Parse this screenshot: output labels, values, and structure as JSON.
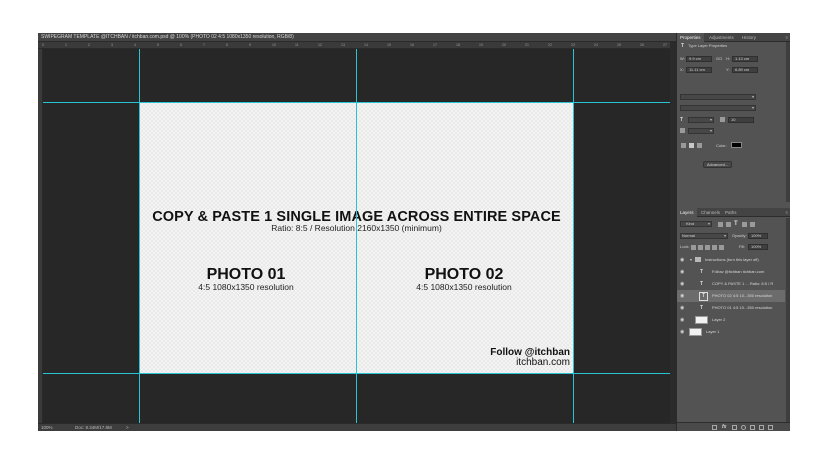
{
  "document": {
    "tab_title": "SWIPEGRAM TEMPLATE @ITCHBAN / itchban.com.psd @ 100% (PHOTO 02 4:5 1080x1350 resolution, RGB/8)"
  },
  "ruler": {
    "ticks": [
      "0",
      "1",
      "2",
      "3",
      "4",
      "5",
      "6",
      "7",
      "8",
      "9",
      "10",
      "11",
      "12",
      "13",
      "14",
      "15",
      "16",
      "17",
      "18",
      "19",
      "20",
      "21",
      "22",
      "23",
      "24",
      "25",
      "26",
      "27"
    ]
  },
  "artboard": {
    "title": "COPY & PASTE 1 SINGLE IMAGE ACROSS ENTIRE SPACE",
    "subtitle": "Ratio: 8:5 / Resolution 2160x1350 (minimum)",
    "photo1_title": "PHOTO 01",
    "photo1_sub": "4:5 1080x1350 resolution",
    "photo2_title": "PHOTO 02",
    "photo2_sub": "4:5 1080x1350 resolution",
    "follow": "Follow @itchban",
    "site": "itchban.com"
  },
  "guides": {
    "color": "#29c4d4"
  },
  "status": {
    "zoom": "100%",
    "doc": "Doc: 8.34M/17.8M",
    "arrow": ">"
  },
  "properties_panel": {
    "tabs": [
      "Properties",
      "Adjustments",
      "History"
    ],
    "heading": "Type Layer Properties",
    "w_label": "W:",
    "w_value": "9.9 cm",
    "go_label": "GO",
    "h_label": "H:",
    "h_value": "1.13 cm",
    "x_label": "X:",
    "x_value": "11.11 cm",
    "y_label": "Y:",
    "y_value": "6.89 cm",
    "size_value": "10",
    "color_label": "Color:",
    "advanced_label": "Advanced..."
  },
  "layers_panel": {
    "tabs": [
      "Layers",
      "Channels",
      "Paths"
    ],
    "kind_label": "Kind",
    "blend_mode": "Normal",
    "opacity_label": "Opacity:",
    "opacity_value": "100%",
    "lock_label": "Lock:",
    "fill_label": "Fill:",
    "fill_value": "100%",
    "layers": [
      {
        "name": "Instructions (turn this layer off)",
        "type": "folder"
      },
      {
        "name": "Follow @itchban  itchban.com",
        "type": "text"
      },
      {
        "name": "COPY & PASTE 1 ... Ratio: 8:5 / R",
        "type": "text"
      },
      {
        "name": "PHOTO 02 4:5 10...350 resolution",
        "type": "text"
      },
      {
        "name": "PHOTO 01 4:5 10...350 resolution",
        "type": "text"
      },
      {
        "name": "Layer 2",
        "type": "pixel"
      },
      {
        "name": "Layer 1",
        "type": "pixel"
      }
    ]
  }
}
